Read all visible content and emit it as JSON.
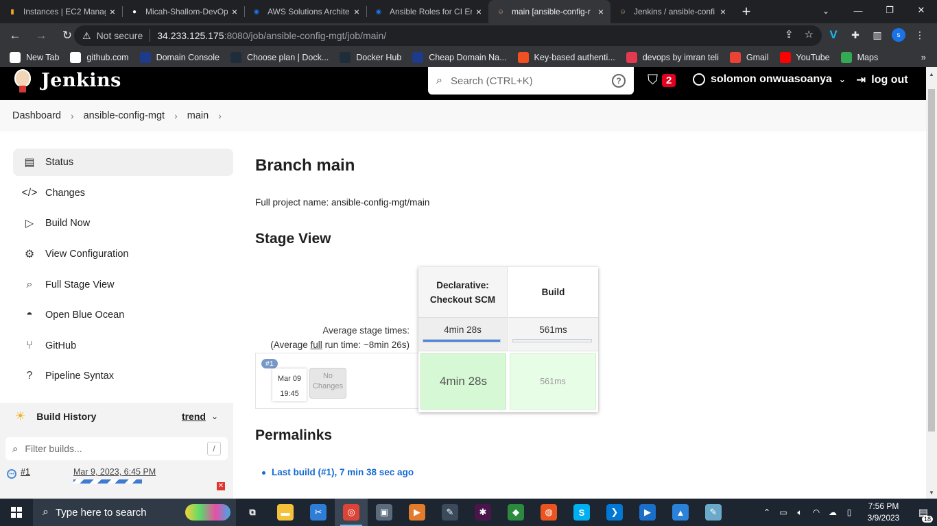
{
  "browser": {
    "tabs": [
      {
        "label": "Instances | EC2 Manag",
        "icon": "aws-icon",
        "color": "#f5a623",
        "glyph": "▮"
      },
      {
        "label": "Micah-Shallom-DevOp",
        "icon": "github-icon",
        "color": "#ffffff",
        "glyph": "●"
      },
      {
        "label": "AWS Solutions Archite",
        "icon": "google-docs-icon",
        "color": "#1a73e8",
        "glyph": "◉"
      },
      {
        "label": "Ansible Roles for CI Er",
        "icon": "google-docs-icon",
        "color": "#1a73e8",
        "glyph": "◉"
      },
      {
        "label": "main [ansible-config-r",
        "icon": "jenkins-icon",
        "color": "#c9a27e",
        "glyph": "☺"
      },
      {
        "label": "Jenkins / ansible-confi",
        "icon": "jenkins-icon",
        "color": "#c9a27e",
        "glyph": "☺"
      }
    ],
    "active_tab": 4,
    "address": {
      "security": "Not secure",
      "host": "34.233.125.175",
      "rest": ":8080/job/ansible-config-mgt/job/main/"
    },
    "profile_initial": "s",
    "bookmarks": [
      {
        "label": "New Tab",
        "icon": "github-icon",
        "color": "#ffffff"
      },
      {
        "label": "github.com",
        "icon": "github-icon",
        "color": "#ffffff"
      },
      {
        "label": "Domain Console",
        "icon": "domain-icon",
        "color": "#1e3a8a"
      },
      {
        "label": "Choose plan | Dock...",
        "icon": "docker-icon",
        "color": "#1f2c3a"
      },
      {
        "label": "Docker Hub",
        "icon": "docker-icon",
        "color": "#1f2c3a"
      },
      {
        "label": "Cheap Domain Na...",
        "icon": "domain-icon",
        "color": "#1e3a8a"
      },
      {
        "label": "Key-based authenti...",
        "icon": "microsoft-icon",
        "color": "#f25022"
      },
      {
        "label": "devops by imran teli",
        "icon": "devops-icon",
        "color": "#e53950"
      },
      {
        "label": "Gmail",
        "icon": "gmail-icon",
        "color": "#ea4335"
      },
      {
        "label": "YouTube",
        "icon": "youtube-icon",
        "color": "#ff0000"
      },
      {
        "label": "Maps",
        "icon": "maps-icon",
        "color": "#34a853"
      }
    ]
  },
  "jenkins": {
    "title": "Jenkins",
    "search_placeholder": "Search (CTRL+K)",
    "security_count": "2",
    "user": "solomon onwuasoanya",
    "logout": "log out"
  },
  "breadcrumb": [
    "Dashboard",
    "ansible-config-mgt",
    "main"
  ],
  "sidebar": {
    "tasks": [
      {
        "label": "Status",
        "icon": "status-icon",
        "glyph": "▤"
      },
      {
        "label": "Changes",
        "icon": "code-icon",
        "glyph": "</>"
      },
      {
        "label": "Build Now",
        "icon": "play-icon",
        "glyph": "▷"
      },
      {
        "label": "View Configuration",
        "icon": "gear-icon",
        "glyph": "⚙"
      },
      {
        "label": "Full Stage View",
        "icon": "search-icon",
        "glyph": "⌕"
      },
      {
        "label": "Open Blue Ocean",
        "icon": "blue-ocean-icon",
        "glyph": "◓"
      },
      {
        "label": "GitHub",
        "icon": "git-branch-icon",
        "glyph": "⑂"
      },
      {
        "label": "Pipeline Syntax",
        "icon": "help-icon",
        "glyph": "?"
      }
    ],
    "build_history": {
      "title": "Build History",
      "trend": "trend",
      "filter_placeholder": "Filter builds...",
      "filter_shortcut": "/",
      "builds": [
        {
          "number": "#1",
          "date": "Mar 9, 2023, 6:45 PM"
        }
      ]
    }
  },
  "main": {
    "title": "Branch main",
    "full_name": "Full project name: ansible-config-mgt/main",
    "stage_view_title": "Stage View",
    "avg_stage_label": "Average stage times:",
    "avg_run_prefix": "(Average ",
    "avg_run_underline": "full",
    "avg_run_suffix": " run time: ~8min 26s)",
    "stages": [
      {
        "name_line1": "Declarative:",
        "name_line2": "Checkout SCM",
        "avg": "4min 28s",
        "avg_fraction": 1.0
      },
      {
        "name_line1": "Build",
        "name_line2": "",
        "avg": "561ms",
        "avg_fraction": 0.0
      }
    ],
    "run": {
      "badge": "#1",
      "month_day": "Mar 09",
      "time": "19:45",
      "no_changes_line1": "No",
      "no_changes_line2": "Changes",
      "cells": [
        "4min 28s",
        "561ms"
      ]
    },
    "permalinks_title": "Permalinks",
    "permalinks": [
      "Last build (#1), 7 min 38 sec ago"
    ]
  },
  "taskbar": {
    "search_placeholder": "Type here to search",
    "apps": [
      {
        "icon": "task-view-icon",
        "color": "transparent",
        "glyph": "⧉"
      },
      {
        "icon": "file-explorer-icon",
        "color": "#f3c23a",
        "glyph": "▬"
      },
      {
        "icon": "snipping-icon",
        "color": "#2e7dd7",
        "glyph": "✂"
      },
      {
        "icon": "chrome-icon",
        "color": "#db4437",
        "glyph": "◎"
      },
      {
        "icon": "photos-icon",
        "color": "#5a6b7c",
        "glyph": "▣"
      },
      {
        "icon": "media-player-icon",
        "color": "#e37b2c",
        "glyph": "▶"
      },
      {
        "icon": "snip-sketch-icon",
        "color": "#3b4b5c",
        "glyph": "✎"
      },
      {
        "icon": "slack-icon",
        "color": "#4a154b",
        "glyph": "✱"
      },
      {
        "icon": "git-icon",
        "color": "#2b8a3e",
        "glyph": "◆"
      },
      {
        "icon": "ubuntu-icon",
        "color": "#e95420",
        "glyph": "◍"
      },
      {
        "icon": "skype-icon",
        "color": "#00aff0",
        "glyph": "S"
      },
      {
        "icon": "vscode-icon",
        "color": "#0078d4",
        "glyph": "❯"
      },
      {
        "icon": "video-editor-icon",
        "color": "#1a6fc9",
        "glyph": "▶"
      },
      {
        "icon": "photos-app-icon",
        "color": "#2a82da",
        "glyph": "▲"
      },
      {
        "icon": "notes-icon",
        "color": "#6aa9c9",
        "glyph": "✎"
      }
    ],
    "time": "7:56 PM",
    "date": "3/9/2023",
    "notifications": "18"
  }
}
